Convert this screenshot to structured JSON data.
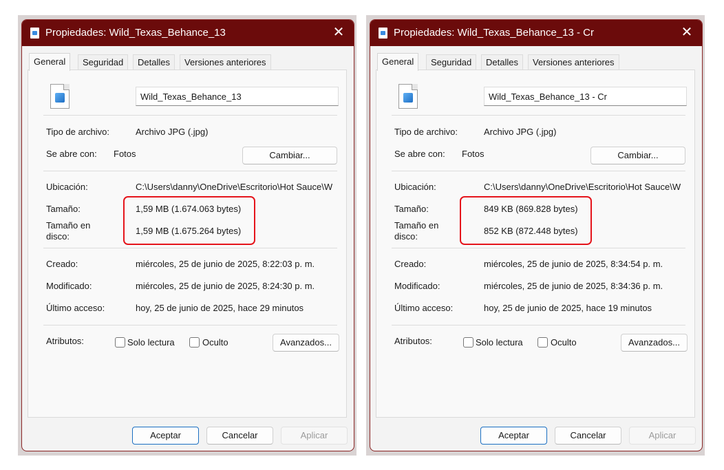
{
  "dialogs": [
    {
      "title": "Propiedades: Wild_Texas_Behance_13",
      "tabs": [
        "General",
        "Seguridad",
        "Detalles",
        "Versiones anteriores"
      ],
      "file_name": "Wild_Texas_Behance_13",
      "tipo_label": "Tipo de archivo:",
      "tipo_value": "Archivo JPG (.jpg)",
      "abre_label": "Se abre con:",
      "abre_value": "Fotos",
      "cambiar_label": "Cambiar...",
      "ubicacion_label": "Ubicación:",
      "ubicacion_value": "C:\\Users\\danny\\OneDrive\\Escritorio\\Hot Sauce\\W",
      "tamano_label": "Tamaño:",
      "tamano_value": "1,59 MB (1.674.063 bytes)",
      "tamano_disco_label_1": "Tamaño en",
      "tamano_disco_label_2": "disco:",
      "tamano_disco_value": "1,59 MB (1.675.264 bytes)",
      "creado_label": "Creado:",
      "creado_value": "miércoles, 25 de junio de 2025, 8:22:03 p. m.",
      "modificado_label": "Modificado:",
      "modificado_value": "miércoles, 25 de junio de 2025, 8:24:30 p. m.",
      "acceso_label": "Último acceso:",
      "acceso_value": "hoy, 25 de junio de 2025, hace 29 minutos",
      "atributos_label": "Atributos:",
      "solo_lectura_label": "Solo lectura",
      "oculto_label": "Oculto",
      "avanzados_label": "Avanzados...",
      "aceptar_label": "Aceptar",
      "cancelar_label": "Cancelar",
      "aplicar_label": "Aplicar"
    },
    {
      "title": "Propiedades: Wild_Texas_Behance_13 - Cr",
      "tabs": [
        "General",
        "Seguridad",
        "Detalles",
        "Versiones anteriores"
      ],
      "file_name": "Wild_Texas_Behance_13 - Cr",
      "tipo_label": "Tipo de archivo:",
      "tipo_value": "Archivo JPG (.jpg)",
      "abre_label": "Se abre con:",
      "abre_value": "Fotos",
      "cambiar_label": "Cambiar...",
      "ubicacion_label": "Ubicación:",
      "ubicacion_value": "C:\\Users\\danny\\OneDrive\\Escritorio\\Hot Sauce\\W",
      "tamano_label": "Tamaño:",
      "tamano_value": "849 KB (869.828 bytes)",
      "tamano_disco_label_1": "Tamaño en",
      "tamano_disco_label_2": "disco:",
      "tamano_disco_value": "852 KB (872.448 bytes)",
      "creado_label": "Creado:",
      "creado_value": "miércoles, 25 de junio de 2025, 8:34:54 p. m.",
      "modificado_label": "Modificado:",
      "modificado_value": "miércoles, 25 de junio de 2025, 8:34:36 p. m.",
      "acceso_label": "Último acceso:",
      "acceso_value": "hoy, 25 de junio de 2025, hace 19 minutos",
      "atributos_label": "Atributos:",
      "solo_lectura_label": "Solo lectura",
      "oculto_label": "Oculto",
      "avanzados_label": "Avanzados...",
      "aceptar_label": "Aceptar",
      "cancelar_label": "Cancelar",
      "aplicar_label": "Aplicar"
    }
  ],
  "colors": {
    "titlebar": "#6b0b0b",
    "highlight": "#e5141b",
    "primary_border": "#1a6fc2"
  },
  "icons": {
    "app": "image-file-icon",
    "close": "close-icon",
    "file": "jpg-file-icon"
  }
}
